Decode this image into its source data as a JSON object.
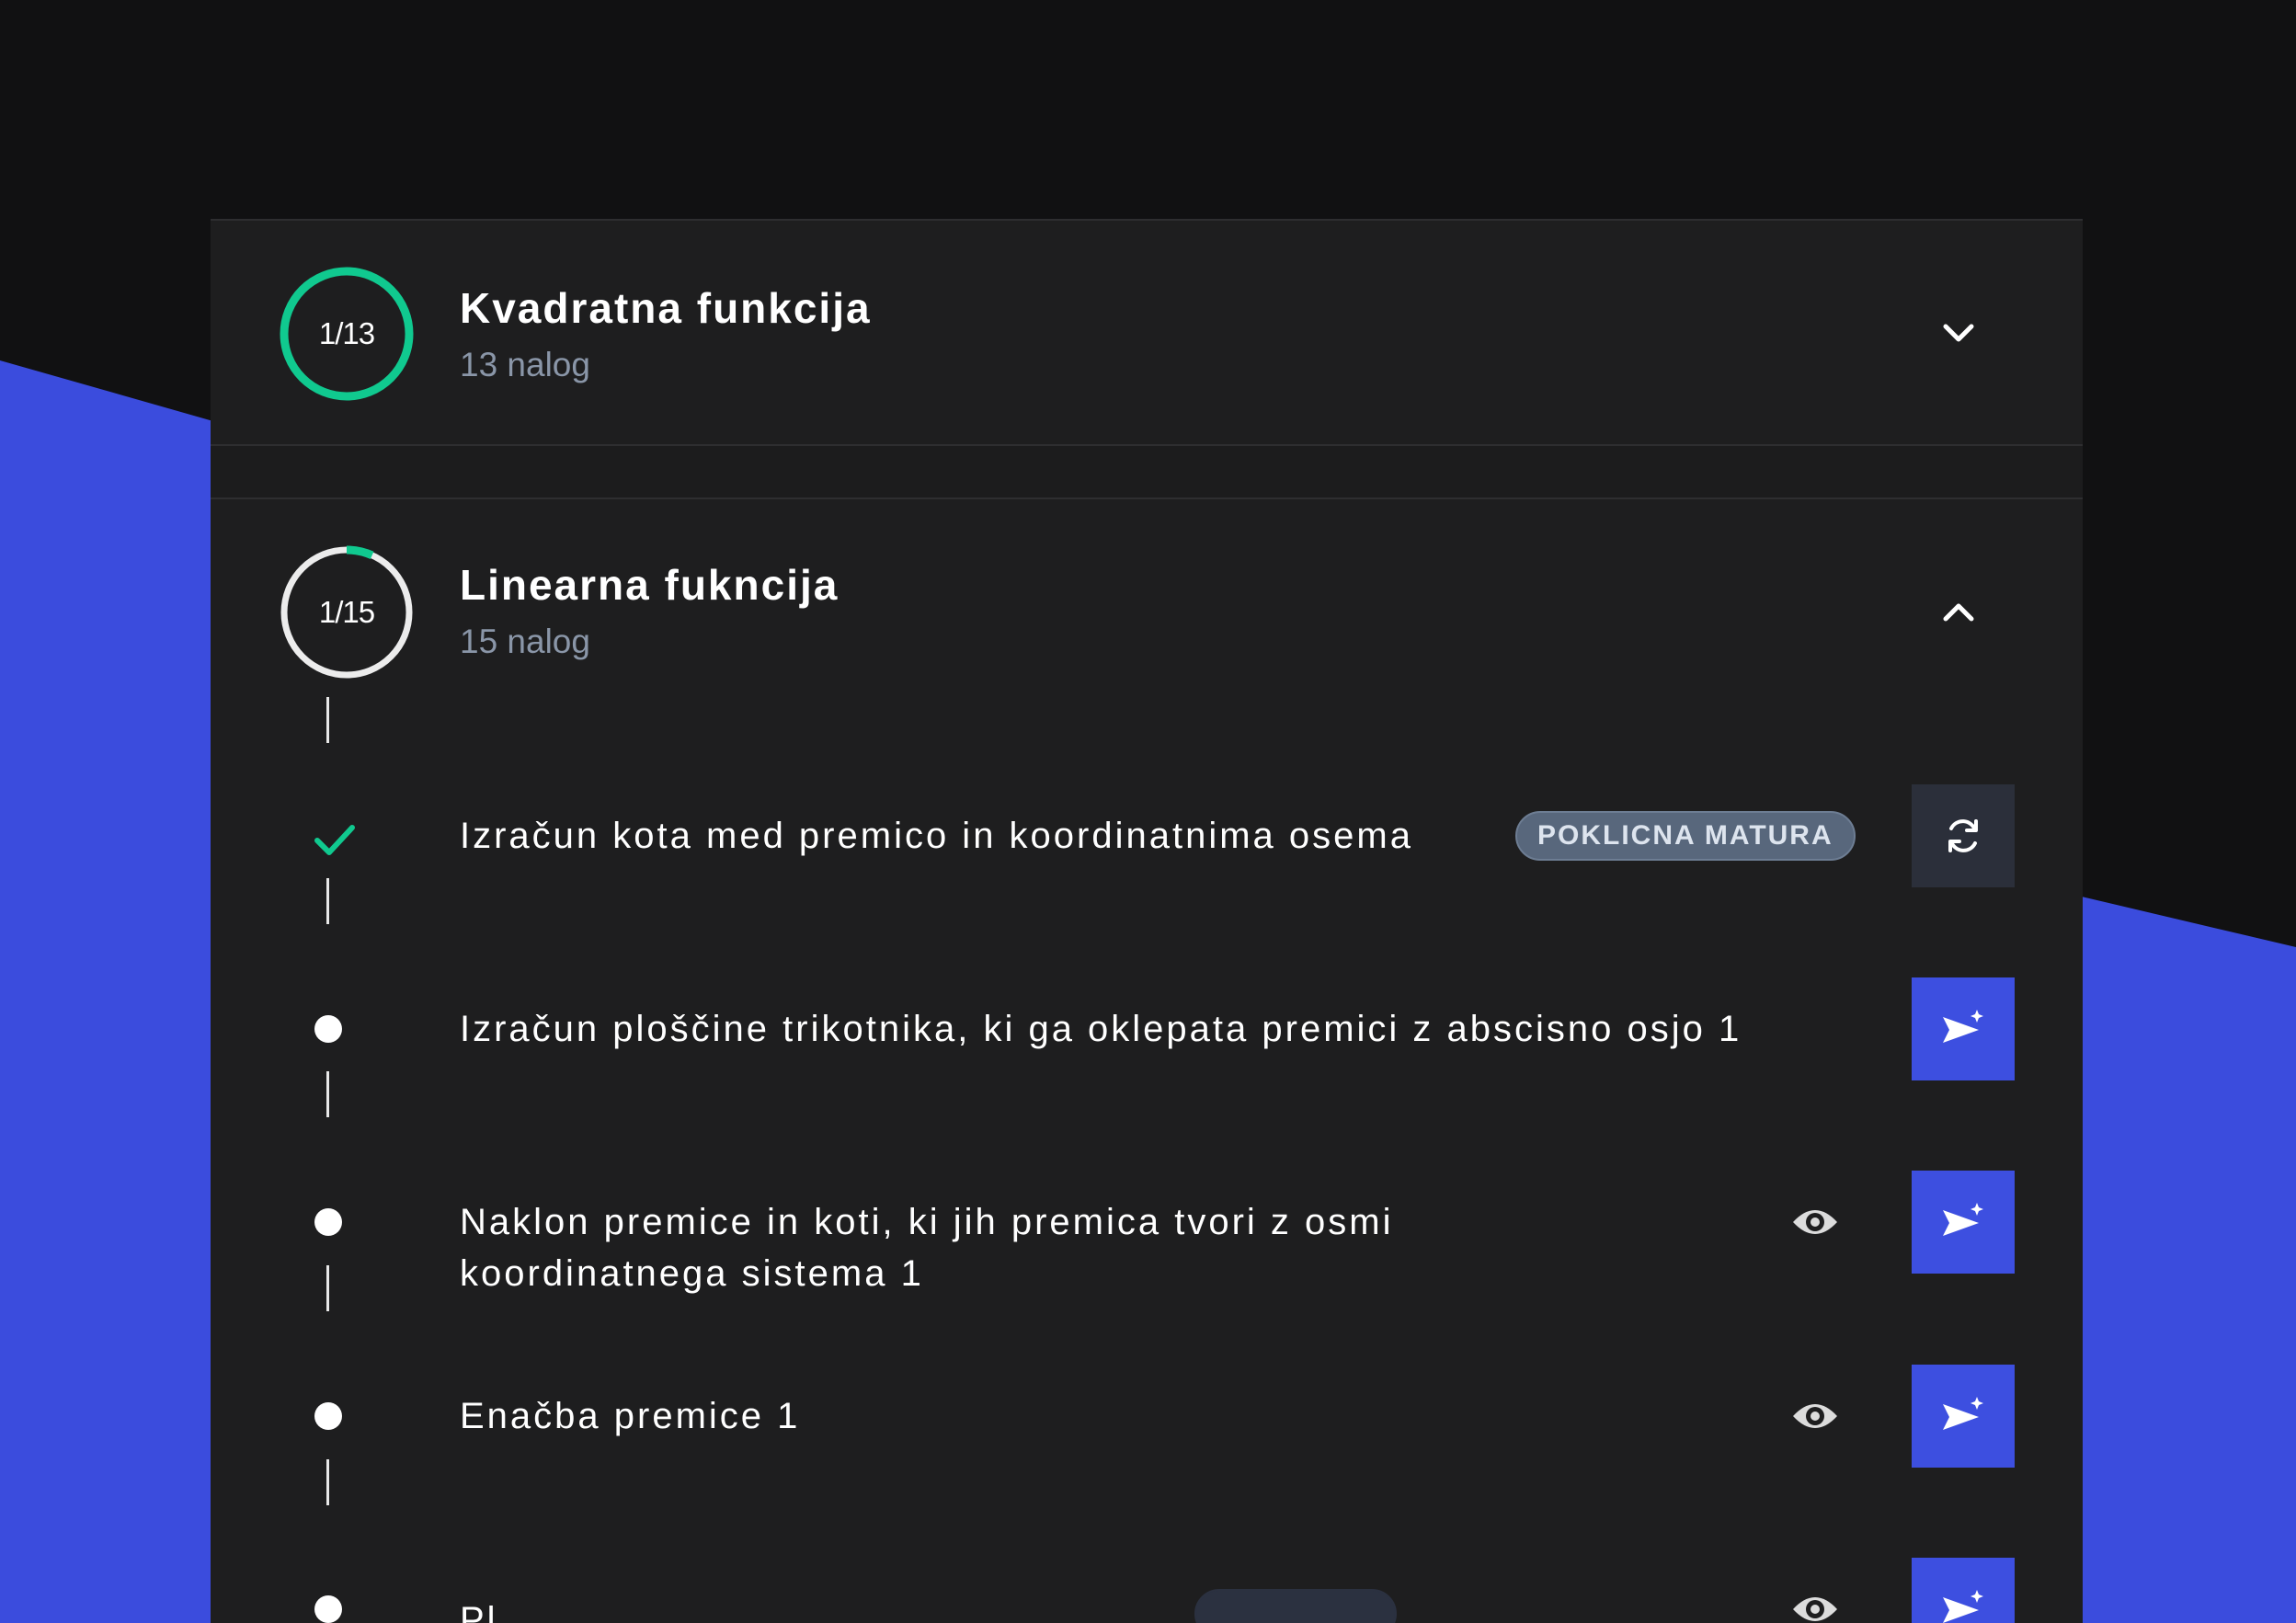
{
  "colors": {
    "background": "#111112",
    "accent_blue": "#3d4fe0",
    "progress_green": "#10c98f",
    "panel": "#1e1e1f",
    "muted_text": "#8a96a8"
  },
  "topics": [
    {
      "progress_label": "1/13",
      "progress_fraction": 1.0,
      "title": "Kvadratna funkcija",
      "subtitle": "13 nalog",
      "expanded": false,
      "toggle_icon": "chevron-down-icon"
    },
    {
      "progress_label": "1/15",
      "progress_fraction": 0.0667,
      "title": "Linearna fukncija",
      "subtitle": "15 nalog",
      "expanded": true,
      "toggle_icon": "chevron-up-icon"
    }
  ],
  "tasks": [
    {
      "title": "Izračun kota med premico in koordinatnima osema",
      "status": "completed",
      "badge": "POKLICNA MATURA",
      "has_preview": false,
      "action_icon": "refresh-icon"
    },
    {
      "title": "Izračun ploščine trikotnika, ki ga oklepata premici z abscisno osjo 1",
      "status": "pending",
      "badge": "",
      "has_preview": false,
      "action_icon": "send-sparkle-icon"
    },
    {
      "title_line1": "Naklon premice in koti, ki jih premica tvori z osmi",
      "title_line2": "koordinatnega sistema 1",
      "status": "pending",
      "badge": "",
      "has_preview": true,
      "action_icon": "send-sparkle-icon"
    },
    {
      "title": "Enačba premice 1",
      "status": "pending",
      "badge": "",
      "has_preview": true,
      "action_icon": "send-sparkle-icon"
    },
    {
      "title": "Pl...",
      "status": "pending",
      "badge": "",
      "has_preview": true,
      "action_icon": "send-sparkle-icon"
    }
  ]
}
